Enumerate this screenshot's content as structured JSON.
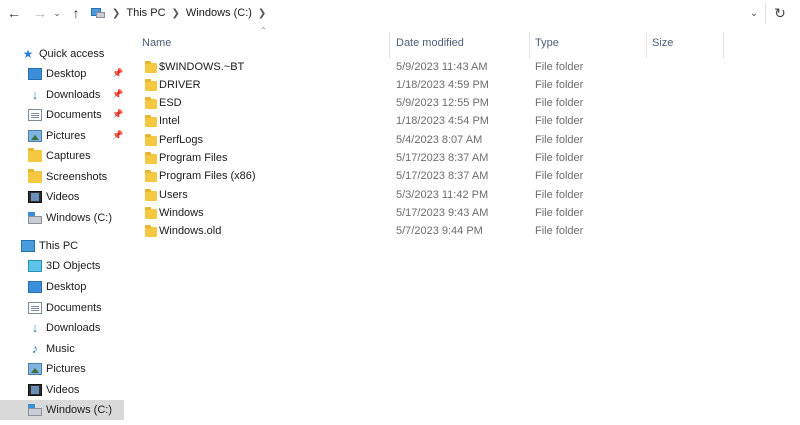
{
  "address_bar": {
    "back_icon": "arrow-left-icon",
    "forward_icon": "arrow-right-icon",
    "recent_icon": "chevron-down-icon",
    "up_icon": "arrow-up-icon",
    "crumbs": [
      "This PC",
      "Windows (C:)"
    ],
    "refresh_icon": "refresh-icon"
  },
  "sidebar": {
    "quick_access": {
      "label": "Quick access",
      "items": [
        {
          "label": "Desktop",
          "icon": "desktop-icon",
          "pinned": true
        },
        {
          "label": "Downloads",
          "icon": "download-icon",
          "pinned": true
        },
        {
          "label": "Documents",
          "icon": "documents-icon",
          "pinned": true
        },
        {
          "label": "Pictures",
          "icon": "pictures-icon",
          "pinned": true
        },
        {
          "label": "Captures",
          "icon": "folder-icon",
          "pinned": false
        },
        {
          "label": "Screenshots",
          "icon": "folder-icon",
          "pinned": false
        },
        {
          "label": "Videos",
          "icon": "videos-icon",
          "pinned": false
        },
        {
          "label": "Windows (C:)",
          "icon": "drive-icon",
          "pinned": false
        }
      ]
    },
    "this_pc": {
      "label": "This PC",
      "items": [
        {
          "label": "3D Objects",
          "icon": "3d-objects-icon"
        },
        {
          "label": "Desktop",
          "icon": "desktop-icon"
        },
        {
          "label": "Documents",
          "icon": "documents-icon"
        },
        {
          "label": "Downloads",
          "icon": "download-icon"
        },
        {
          "label": "Music",
          "icon": "music-icon"
        },
        {
          "label": "Pictures",
          "icon": "pictures-icon"
        },
        {
          "label": "Videos",
          "icon": "videos-icon"
        },
        {
          "label": "Windows (C:)",
          "icon": "drive-icon",
          "selected": true
        }
      ]
    }
  },
  "file_list": {
    "columns": [
      "Name",
      "Date modified",
      "Type",
      "Size"
    ],
    "rows": [
      {
        "name": "$WINDOWS.~BT",
        "date": "5/9/2023 11:43 AM",
        "type": "File folder",
        "size": ""
      },
      {
        "name": "DRIVER",
        "date": "1/18/2023 4:59 PM",
        "type": "File folder",
        "size": ""
      },
      {
        "name": "ESD",
        "date": "5/9/2023 12:55 PM",
        "type": "File folder",
        "size": ""
      },
      {
        "name": "Intel",
        "date": "1/18/2023 4:54 PM",
        "type": "File folder",
        "size": ""
      },
      {
        "name": "PerfLogs",
        "date": "5/4/2023 8:07 AM",
        "type": "File folder",
        "size": ""
      },
      {
        "name": "Program Files",
        "date": "5/17/2023 8:37 AM",
        "type": "File folder",
        "size": ""
      },
      {
        "name": "Program Files (x86)",
        "date": "5/17/2023 8:37 AM",
        "type": "File folder",
        "size": ""
      },
      {
        "name": "Users",
        "date": "5/3/2023 11:42 PM",
        "type": "File folder",
        "size": ""
      },
      {
        "name": "Windows",
        "date": "5/17/2023 9:43 AM",
        "type": "File folder",
        "size": ""
      },
      {
        "name": "Windows.old",
        "date": "5/7/2023 9:44 PM",
        "type": "File folder",
        "size": ""
      }
    ]
  },
  "colors": {
    "folder": "#f5c842",
    "selected_bg": "#d9d9d9",
    "header_text": "#4c607a",
    "accent": "#2b7bd3"
  }
}
